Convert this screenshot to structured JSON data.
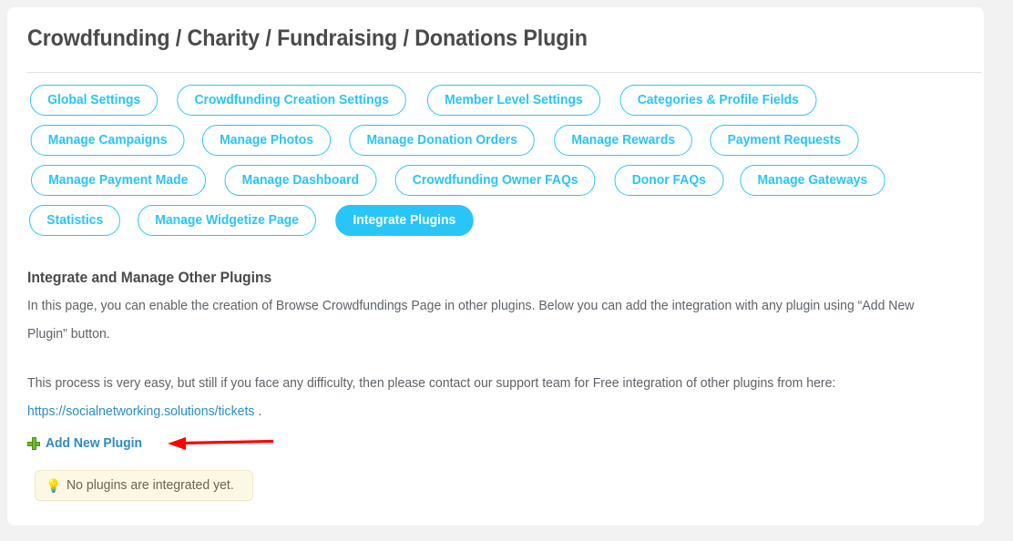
{
  "page": {
    "title": "Crowdfunding / Charity / Fundraising / Donations Plugin",
    "background_color": "#f2f2f2",
    "card_color": "#ffffff",
    "accent_color": "#29c5f6",
    "link_color": "#2b8cc4",
    "arrow_color": "#ff0000"
  },
  "tabs": {
    "active_label": "Integrate Plugins",
    "rows": [
      [
        {
          "label": "Global Settings",
          "active": false
        },
        {
          "label": "Crowdfunding Creation Settings",
          "active": false
        },
        {
          "label": "Member Level Settings",
          "active": false
        },
        {
          "label": "Categories & Profile Fields",
          "active": false
        }
      ],
      [
        {
          "label": "Manage Campaigns",
          "active": false
        },
        {
          "label": "Manage Photos",
          "active": false
        },
        {
          "label": "Manage Donation Orders",
          "active": false
        },
        {
          "label": "Manage Rewards",
          "active": false
        },
        {
          "label": "Payment Requests",
          "active": false
        }
      ],
      [
        {
          "label": "Manage Payment Made",
          "active": false
        },
        {
          "label": "Manage Dashboard",
          "active": false
        },
        {
          "label": "Crowdfunding Owner FAQs",
          "active": false
        },
        {
          "label": "Donor FAQs",
          "active": false
        },
        {
          "label": "Manage Gateways",
          "active": false
        }
      ],
      [
        {
          "label": "Statistics",
          "active": false
        },
        {
          "label": "Manage Widgetize Page",
          "active": false
        },
        {
          "label": "Integrate Plugins",
          "active": true
        }
      ]
    ]
  },
  "content": {
    "section_heading": "Integrate and Manage Other Plugins",
    "intro_paragraph": "In this page, you can enable the creation of Browse Crowdfundings Page in other plugins. Below you can add the integration with any plugin using “Add New Plugin” button.",
    "support_paragraph_before_link": "This process is very easy, but still if you face any difficulty, then please contact our support team for Free integration of other plugins from here:",
    "support_link_text": "https://socialnetworking.solutions/tickets",
    "support_paragraph_after_link": " .",
    "add_new_plugin_label": "Add New Plugin",
    "add_new_plugin_icon": "plus-icon",
    "notice_icon": "lightbulb-icon",
    "notice_text": "No plugins are integrated yet."
  }
}
